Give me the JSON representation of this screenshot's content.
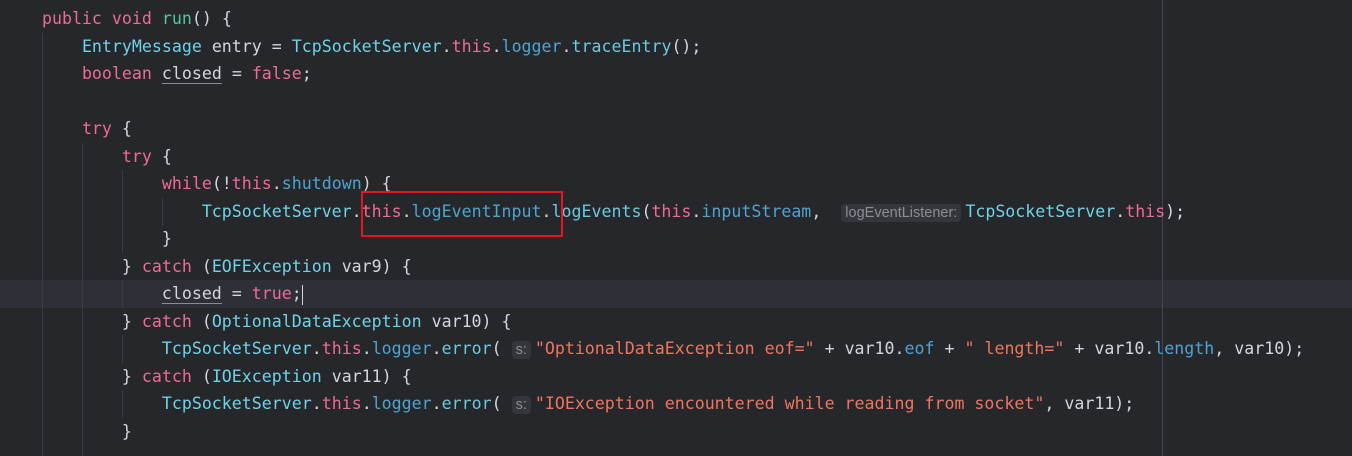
{
  "editor": {
    "current_line": 10,
    "highlight_box_target": "this.logEventInput",
    "colors": {
      "background": "#26272b",
      "keyword": "#ee6a9a",
      "type": "#6fd2e6",
      "field": "#4ea3cf",
      "string": "#ef7560",
      "highlight_box": "#e8141e"
    },
    "lines": [
      {
        "indent": 4,
        "tokens": [
          {
            "t": "public",
            "c": "kw"
          },
          {
            "t": " "
          },
          {
            "t": "void",
            "c": "kw"
          },
          {
            "t": " "
          },
          {
            "t": "run",
            "c": "fn"
          },
          {
            "t": "() {"
          }
        ]
      },
      {
        "indent": 8,
        "tokens": [
          {
            "t": "EntryMessage",
            "c": "type"
          },
          {
            "t": " entry = "
          },
          {
            "t": "TcpSocketServer",
            "c": "type"
          },
          {
            "t": "."
          },
          {
            "t": "this",
            "c": "kw"
          },
          {
            "t": "."
          },
          {
            "t": "logger",
            "c": "field"
          },
          {
            "t": "."
          },
          {
            "t": "traceEntry",
            "c": "method"
          },
          {
            "t": "();"
          }
        ]
      },
      {
        "indent": 8,
        "tokens": [
          {
            "t": "boolean",
            "c": "kw"
          },
          {
            "t": " "
          },
          {
            "t": "closed",
            "c": "ul"
          },
          {
            "t": " = "
          },
          {
            "t": "false",
            "c": "kw"
          },
          {
            "t": ";"
          }
        ]
      },
      {
        "indent": 0,
        "tokens": []
      },
      {
        "indent": 8,
        "tokens": [
          {
            "t": "try",
            "c": "kw"
          },
          {
            "t": " {"
          }
        ]
      },
      {
        "indent": 12,
        "tokens": [
          {
            "t": "try",
            "c": "kw"
          },
          {
            "t": " {"
          }
        ]
      },
      {
        "indent": 16,
        "tokens": [
          {
            "t": "while",
            "c": "kw"
          },
          {
            "t": "(!"
          },
          {
            "t": "this",
            "c": "kw"
          },
          {
            "t": "."
          },
          {
            "t": "shutdown",
            "c": "field"
          },
          {
            "t": ") {"
          }
        ]
      },
      {
        "indent": 20,
        "tokens": [
          {
            "t": "TcpSocketServer",
            "c": "type"
          },
          {
            "t": "."
          },
          {
            "t": "this",
            "c": "kw"
          },
          {
            "t": "."
          },
          {
            "t": "logEventInput",
            "c": "field"
          },
          {
            "t": "."
          },
          {
            "t": "logEvents",
            "c": "method"
          },
          {
            "t": "("
          },
          {
            "t": "this",
            "c": "kw"
          },
          {
            "t": "."
          },
          {
            "t": "inputStream",
            "c": "field"
          },
          {
            "t": ",  "
          },
          {
            "t": "logEventListener:",
            "c": "hint"
          },
          {
            "t": "TcpSocketServer",
            "c": "type"
          },
          {
            "t": "."
          },
          {
            "t": "this",
            "c": "kw"
          },
          {
            "t": ");"
          }
        ]
      },
      {
        "indent": 16,
        "tokens": [
          {
            "t": "}"
          }
        ]
      },
      {
        "indent": 12,
        "tokens": [
          {
            "t": "} "
          },
          {
            "t": "catch",
            "c": "kw"
          },
          {
            "t": " ("
          },
          {
            "t": "EOFException",
            "c": "type"
          },
          {
            "t": " var9) {"
          }
        ]
      },
      {
        "indent": 16,
        "tokens": [
          {
            "t": "closed",
            "c": "ul"
          },
          {
            "t": " = "
          },
          {
            "t": "true",
            "c": "kw"
          },
          {
            "t": ";"
          },
          {
            "t": "",
            "c": "caret"
          }
        ]
      },
      {
        "indent": 12,
        "tokens": [
          {
            "t": "} "
          },
          {
            "t": "catch",
            "c": "kw"
          },
          {
            "t": " ("
          },
          {
            "t": "OptionalDataException",
            "c": "type"
          },
          {
            "t": " var10) {"
          }
        ]
      },
      {
        "indent": 16,
        "tokens": [
          {
            "t": "TcpSocketServer",
            "c": "type"
          },
          {
            "t": "."
          },
          {
            "t": "this",
            "c": "kw"
          },
          {
            "t": "."
          },
          {
            "t": "logger",
            "c": "field"
          },
          {
            "t": "."
          },
          {
            "t": "error",
            "c": "method"
          },
          {
            "t": "( "
          },
          {
            "t": "s:",
            "c": "hint"
          },
          {
            "t": "\"OptionalDataException eof=\"",
            "c": "str"
          },
          {
            "t": " + var10."
          },
          {
            "t": "eof",
            "c": "field"
          },
          {
            "t": " + "
          },
          {
            "t": "\" length=\"",
            "c": "str"
          },
          {
            "t": " + var10."
          },
          {
            "t": "length",
            "c": "field"
          },
          {
            "t": ", var10);"
          }
        ]
      },
      {
        "indent": 12,
        "tokens": [
          {
            "t": "} "
          },
          {
            "t": "catch",
            "c": "kw"
          },
          {
            "t": " ("
          },
          {
            "t": "IOException",
            "c": "type"
          },
          {
            "t": " var11) {"
          }
        ]
      },
      {
        "indent": 16,
        "tokens": [
          {
            "t": "TcpSocketServer",
            "c": "type"
          },
          {
            "t": "."
          },
          {
            "t": "this",
            "c": "kw"
          },
          {
            "t": "."
          },
          {
            "t": "logger",
            "c": "field"
          },
          {
            "t": "."
          },
          {
            "t": "error",
            "c": "method"
          },
          {
            "t": "( "
          },
          {
            "t": "s:",
            "c": "hint"
          },
          {
            "t": "\"IOException encountered while reading from socket\"",
            "c": "str"
          },
          {
            "t": ", var11);"
          }
        ]
      },
      {
        "indent": 12,
        "tokens": [
          {
            "t": "}"
          }
        ]
      }
    ]
  }
}
